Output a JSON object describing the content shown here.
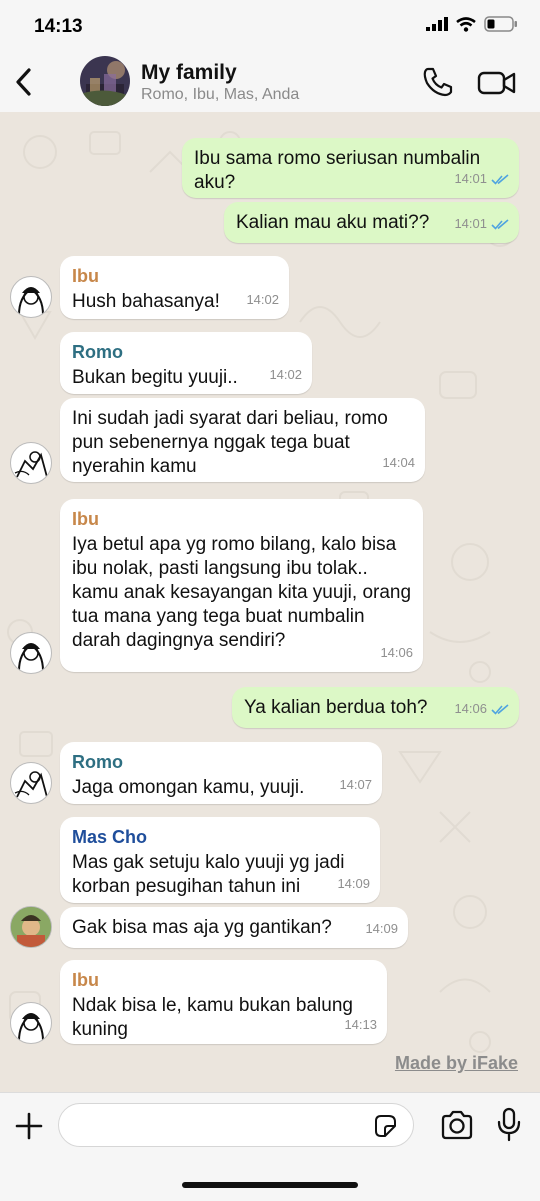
{
  "status": {
    "time": "14:13"
  },
  "header": {
    "title": "My family",
    "subtitle": "Romo, Ibu, Mas, Anda"
  },
  "messages": [
    {
      "dir": "out",
      "text": "Ibu sama romo seriusan numbalin aku?",
      "time": "14:01"
    },
    {
      "dir": "out",
      "text": "Kalian mau aku mati??",
      "time": "14:01"
    },
    {
      "dir": "in",
      "sender": "Ibu",
      "text": "Hush bahasanya!",
      "time": "14:02"
    },
    {
      "dir": "in",
      "sender": "Romo",
      "text": "Bukan begitu yuuji..",
      "time": "14:02"
    },
    {
      "dir": "in",
      "text": "Ini sudah jadi syarat dari beliau, romo pun sebenernya nggak tega buat nyerahin kamu",
      "time": "14:04"
    },
    {
      "dir": "in",
      "sender": "Ibu",
      "text": "Iya betul apa yg romo bilang, kalo bisa ibu nolak, pasti langsung ibu tolak.. kamu anak kesayangan kita yuuji, orang tua mana yang tega buat numbalin darah dagingnya sendiri?",
      "time": "14:06"
    },
    {
      "dir": "out",
      "text": "Ya kalian berdua toh?",
      "time": "14:06"
    },
    {
      "dir": "in",
      "sender": "Romo",
      "text": "Jaga omongan kamu, yuuji.",
      "time": "14:07"
    },
    {
      "dir": "in",
      "sender": "Mas Cho",
      "text": "Mas gak setuju kalo yuuji yg jadi korban pesugihan tahun ini",
      "time": "14:09"
    },
    {
      "dir": "in",
      "text": "Gak bisa mas aja yg gantikan?",
      "time": "14:09"
    },
    {
      "dir": "in",
      "sender": "Ibu",
      "text": "Ndak bisa le, kamu bukan balung kuning",
      "time": "14:13"
    }
  ],
  "watermark": "Made by iFake",
  "composer": {
    "placeholder": ""
  },
  "colors": {
    "outgoing_bubble": "#dcf8c6",
    "incoming_bubble": "#ffffff",
    "sender_ibu": "#c7874a",
    "sender_romo": "#2e6f82",
    "sender_mascho": "#1f4e9b",
    "read_tick": "#4fa3e0"
  },
  "icons": [
    "back-icon",
    "phone-icon",
    "video-icon",
    "plus-icon",
    "sticker-icon",
    "camera-icon",
    "mic-icon",
    "double-tick-icon"
  ]
}
